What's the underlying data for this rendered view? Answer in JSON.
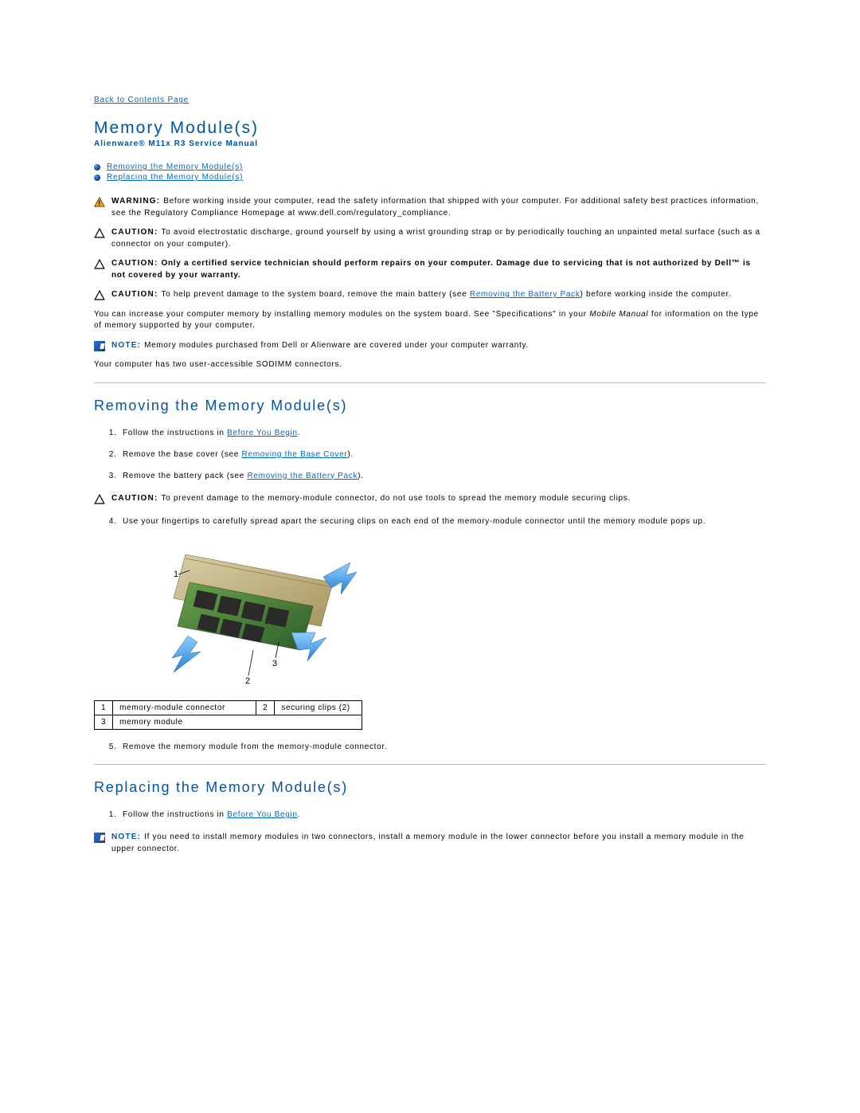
{
  "nav": {
    "back": "Back to Contents Page"
  },
  "title": "Memory Module(s)",
  "subtitle": "Alienware® M11x R3 Service Manual",
  "toc": {
    "item1": "Removing the Memory Module(s)",
    "item2": "Replacing the Memory Module(s)"
  },
  "warn1": {
    "lead": "WARNING: ",
    "text": "Before working inside your computer, read the safety information that shipped with your computer. For additional safety best practices information, see the Regulatory Compliance Homepage at www.dell.com/regulatory_compliance."
  },
  "caut1": {
    "lead": "CAUTION: ",
    "text": "To avoid electrostatic discharge, ground yourself by using a wrist grounding strap or by periodically touching an unpainted metal surface (such as a connector on your computer)."
  },
  "caut2": {
    "lead": "CAUTION: ",
    "bold": "Only a certified service technician should perform repairs on your computer. Damage due to servicing that is not authorized by Dell™ is not covered by your warranty."
  },
  "caut3": {
    "lead": "CAUTION: ",
    "pre": "To help prevent damage to the system board, remove the main battery (see ",
    "link": "Removing the Battery Pack",
    "post": ") before working inside the computer."
  },
  "para_increase_pre": "You can increase your computer memory by installing memory modules on the system board. See \"Specifications\" in your ",
  "para_increase_italic": "Mobile Manual",
  "para_increase_post": " for information on the type of memory supported by your computer.",
  "note1": {
    "lead": "NOTE: ",
    "text": "Memory modules purchased from Dell or Alienware are covered under your computer warranty."
  },
  "para_sodimm": "Your computer has two user-accessible SODIMM connectors.",
  "section_remove": "Removing the Memory Module(s)",
  "steps_remove": {
    "s1_pre": "Follow the instructions in ",
    "s1_link": "Before You Begin",
    "s1_post": ".",
    "s2_pre": "Remove the base cover (see ",
    "s2_link": "Removing the Base Cover",
    "s2_post": ").",
    "s3_pre": "Remove the battery pack (see ",
    "s3_link": "Removing the Battery Pack",
    "s3_post": ").",
    "s4": "Use your fingertips to carefully spread apart the securing clips on each end of the memory-module connector until the memory module pops up.",
    "s5": "Remove the memory module from the memory-module connector."
  },
  "caut4": {
    "lead": "CAUTION: ",
    "text": "To prevent damage to the memory-module connector, do not use tools to spread the memory module securing clips."
  },
  "legend": {
    "n1": "1",
    "l1": "memory-module connector",
    "n2": "2",
    "l2": "securing clips (2)",
    "n3": "3",
    "l3": "memory module"
  },
  "section_replace": "Replacing the Memory Module(s)",
  "steps_replace": {
    "s1_pre": "Follow the instructions in ",
    "s1_link": "Before You Begin",
    "s1_post": "."
  },
  "note2": {
    "lead": "NOTE: ",
    "text": "If you need to install memory modules in two connectors, install a memory module in the lower connector before you install a memory module in the upper connector."
  },
  "diagram_callouts": {
    "c1": "1",
    "c2": "2",
    "c3": "3"
  }
}
